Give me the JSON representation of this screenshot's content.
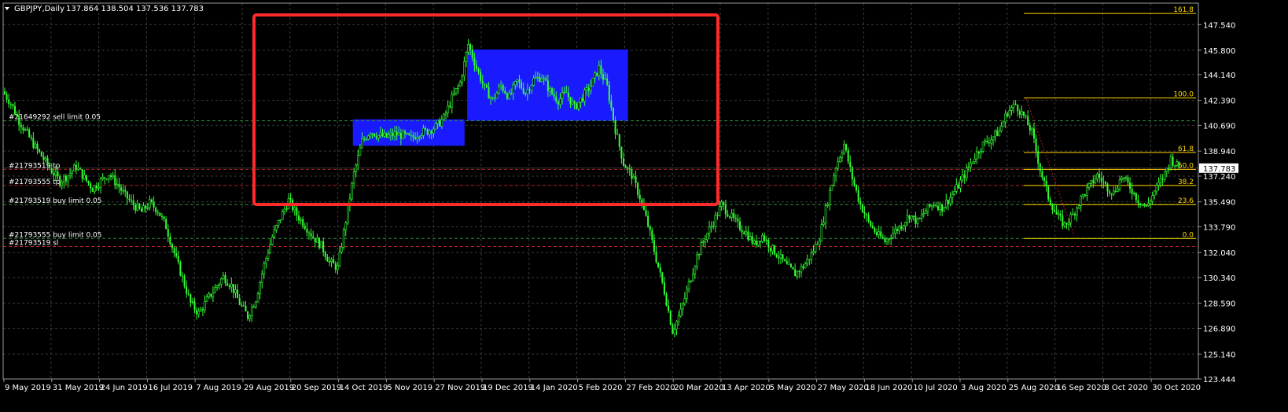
{
  "window": {
    "symbol_title": "GBPJPY,Daily",
    "ohlc": "137.864 138.504 137.536 137.783"
  },
  "chart_data": {
    "type": "candlestick",
    "ylim": [
      123.444,
      149.0
    ],
    "y_ticks": [
      "147.540",
      "145.800",
      "144.140",
      "142.390",
      "140.690",
      "138.940",
      "137.240",
      "135.490",
      "133.790",
      "132.040",
      "130.340",
      "128.590",
      "126.890",
      "125.140",
      "123.444"
    ],
    "current_price": "137.783",
    "x_labels": [
      "9 May 2019",
      "31 May 2019",
      "24 Jun 2019",
      "16 Jul 2019",
      "7 Aug 2019",
      "29 Aug 2019",
      "20 Sep 2019",
      "14 Oct 2019",
      "5 Nov 2019",
      "27 Nov 2019",
      "19 Dec 2019",
      "14 Jan 2020",
      "5 Feb 2020",
      "27 Feb 2020",
      "20 Mar 2020",
      "13 Apr 2020",
      "5 May 2020",
      "27 May 2020",
      "18 Jun 2020",
      "10 Jul 2020",
      "3 Aug 2020",
      "25 Aug 2020",
      "16 Sep 2020",
      "8 Oct 2020",
      "30 Oct 2020"
    ],
    "close_path": [
      143.0,
      142.2,
      141.0,
      140.1,
      139.2,
      138.4,
      137.6,
      136.9,
      137.3,
      137.9,
      137.1,
      136.4,
      136.9,
      137.4,
      136.7,
      135.9,
      135.3,
      134.8,
      135.4,
      134.9,
      133.8,
      132.0,
      130.3,
      128.6,
      127.9,
      128.8,
      129.6,
      130.4,
      129.8,
      128.6,
      127.7,
      128.9,
      131.2,
      133.1,
      134.4,
      135.6,
      134.6,
      133.9,
      133.1,
      132.5,
      131.4,
      131.0,
      134.2,
      137.4,
      139.6,
      140.3,
      140.0,
      139.9,
      140.1,
      140.0,
      139.8,
      140.2,
      140.3,
      140.6,
      141.2,
      142.5,
      143.6,
      146.2,
      144.6,
      143.2,
      142.4,
      143.4,
      142.6,
      143.7,
      142.9,
      143.8,
      144.0,
      143.0,
      142.4,
      142.9,
      141.9,
      142.6,
      143.4,
      144.6,
      143.3,
      140.4,
      138.1,
      137.3,
      135.8,
      133.9,
      131.6,
      129.4,
      126.7,
      128.0,
      129.9,
      131.8,
      133.1,
      134.1,
      135.3,
      134.6,
      133.9,
      133.4,
      132.6,
      133.2,
      132.4,
      131.8,
      131.1,
      130.6,
      131.1,
      131.9,
      133.1,
      135.6,
      137.9,
      139.4,
      137.1,
      135.3,
      134.1,
      133.3,
      132.8,
      133.4,
      133.9,
      134.6,
      134.1,
      134.9,
      135.4,
      135.1,
      135.8,
      136.6,
      137.6,
      138.6,
      139.4,
      139.8,
      140.3,
      141.6,
      142.1,
      141.3,
      140.2,
      137.7,
      135.8,
      134.6,
      133.9,
      134.6,
      135.7,
      136.5,
      137.3,
      136.6,
      136.1,
      137.2,
      136.5,
      135.6,
      135.1,
      136.2,
      137.1,
      138.4,
      137.8
    ],
    "price_lines": [
      {
        "label": "#21649292 sell limit 0.05",
        "price": 141.0,
        "color": "#2e8b3d"
      },
      {
        "label": "#21793519 tp",
        "price": 137.7,
        "color": "#b22222"
      },
      {
        "label": "#21793555 tp",
        "price": 136.6,
        "color": "#b22222"
      },
      {
        "label": "#21793519 buy limit 0.05",
        "price": 135.3,
        "color": "#2e8b3d"
      },
      {
        "label": "#21793555 buy limit 0.05",
        "price": 133.0,
        "color": "#2e8b3d"
      },
      {
        "label": "#21793519 sl",
        "price": 132.45,
        "color": "#b22222"
      }
    ],
    "fibonacci": [
      {
        "label": "161.8",
        "price": 148.3
      },
      {
        "label": "100.0",
        "price": 142.55
      },
      {
        "label": "61.8",
        "price": 138.85
      },
      {
        "label": "50.0",
        "price": 137.7
      },
      {
        "label": "38.2",
        "price": 136.6
      },
      {
        "label": "23.6",
        "price": 135.3
      },
      {
        "label": "0.0",
        "price": 133.0
      }
    ],
    "boxes": [
      {
        "name": "consolidation-box-1",
        "top": 141.1,
        "bottom": 139.3,
        "color": "#1a1aff"
      },
      {
        "name": "consolidation-box-2",
        "top": 145.85,
        "bottom": 141.0,
        "color": "#1a1aff"
      }
    ],
    "highlight_rect": {
      "color": "#ff2a2a"
    },
    "grid": true,
    "colors": {
      "candle": "#33ff33",
      "grid": "#3a3a3a",
      "axis": "#ffffff",
      "fib": "#ffd700",
      "box": "#1a1aff",
      "highlight": "#ff2a2a"
    }
  }
}
